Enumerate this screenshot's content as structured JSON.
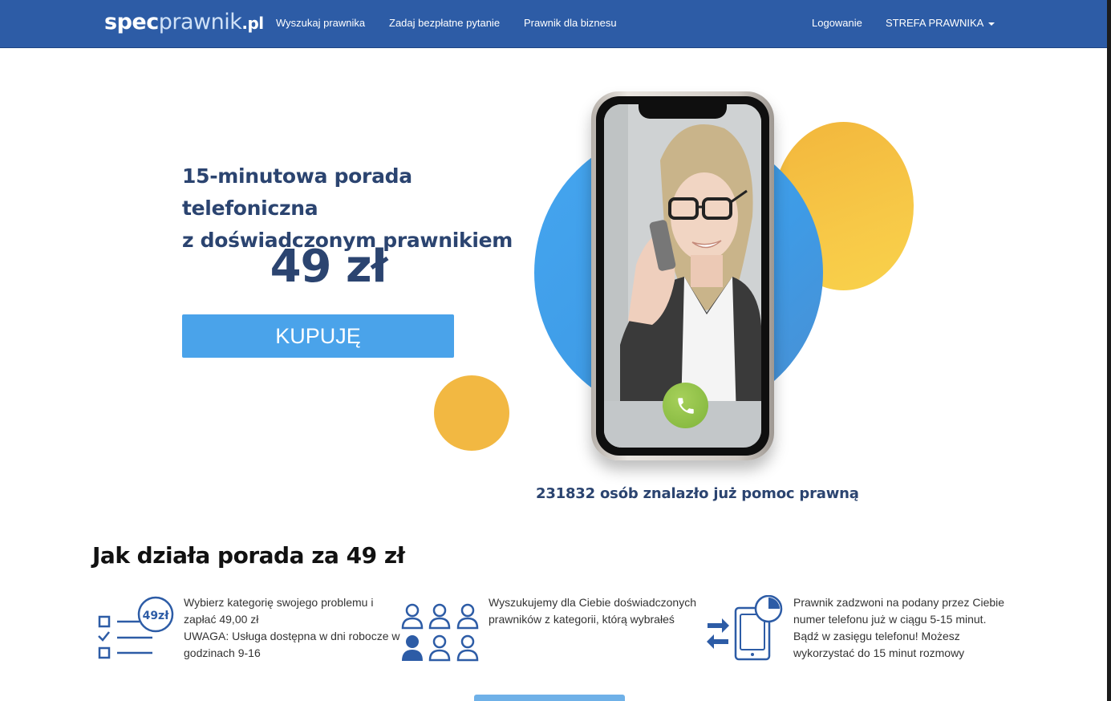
{
  "navbar": {
    "logo": {
      "spec": "spec",
      "prawnik": "prawnik",
      "pl": ".pl"
    },
    "links": [
      {
        "label": "Wyszukaj prawnika"
      },
      {
        "label": "Zadaj bezpłatne pytanie"
      },
      {
        "label": "Prawnik dla biznesu"
      }
    ],
    "login": "Logowanie",
    "lawyer_zone": "STREFA PRAWNIKA"
  },
  "hero": {
    "title_line1": "15-minutowa porada telefoniczna",
    "title_line2": "z doświadczonym prawnikiem",
    "price": "49 zł",
    "buy_button": "KUPUJĘ",
    "counter": "231832 osób znalazło już pomoc prawną"
  },
  "how_it_works": {
    "title": "Jak działa porada za 49 zł",
    "steps": [
      {
        "icon": "checklist-price-icon",
        "icon_text": "49zł",
        "lines": [
          "Wybierz kategorię swojego problemu i",
          "zapłać 49,00 zł",
          "UWAGA: Usługa dostępna w dni robocze w",
          "godzinach 9-16"
        ]
      },
      {
        "icon": "people-group-icon",
        "lines": [
          "Wyszukujemy dla Ciebie doświadczonych",
          "prawników z kategorii, którą wybrałeś"
        ]
      },
      {
        "icon": "phone-call-icon",
        "lines": [
          "Prawnik zadzwoni na podany przez Ciebie",
          "numer telefonu już w ciągu 5-15 minut.",
          "Bądź w zasięgu telefonu! Możesz",
          "wykorzystać do 15 minut rozmowy"
        ]
      }
    ]
  },
  "colors": {
    "navbar": "#2d5ca6",
    "heading": "#2b4470",
    "button": "#4aa3ea",
    "icon_blue": "#2d5ca6",
    "yellow": "#f2b842",
    "green_call": "#8bbd45"
  }
}
